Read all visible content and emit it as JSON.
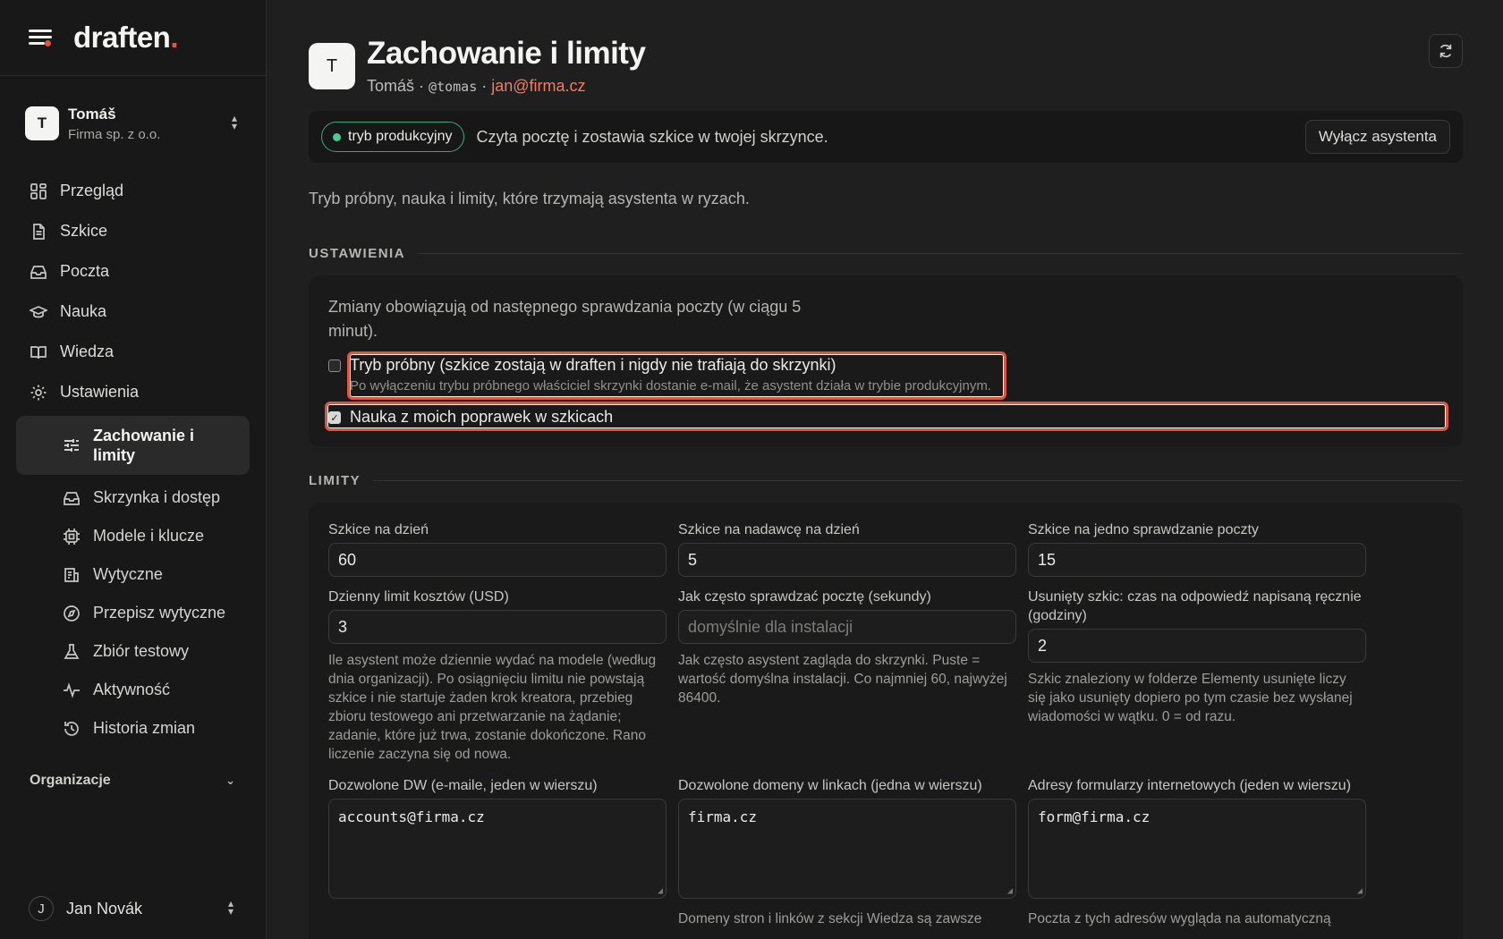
{
  "brand": {
    "name": "draften",
    "dot": "."
  },
  "account": {
    "initial": "T",
    "name": "Tomáš",
    "org": "Firma sp. z o.o."
  },
  "nav": {
    "items": [
      {
        "label": "Przegląd",
        "icon": "grid-icon"
      },
      {
        "label": "Szkice",
        "icon": "document-icon"
      },
      {
        "label": "Poczta",
        "icon": "inbox-icon"
      },
      {
        "label": "Nauka",
        "icon": "graduation-cap-icon"
      },
      {
        "label": "Wiedza",
        "icon": "book-icon"
      },
      {
        "label": "Ustawienia",
        "icon": "gear-icon"
      }
    ],
    "settings_sub": [
      {
        "label": "Zachowanie i limity",
        "icon": "sliders-icon",
        "active": true
      },
      {
        "label": "Skrzynka i dostęp",
        "icon": "inbox-icon"
      },
      {
        "label": "Modele i klucze",
        "icon": "cpu-icon"
      },
      {
        "label": "Wytyczne",
        "icon": "guidelines-icon"
      },
      {
        "label": "Przepisz wytyczne",
        "icon": "compass-icon"
      },
      {
        "label": "Zbiór testowy",
        "icon": "flask-icon"
      },
      {
        "label": "Aktywność",
        "icon": "activity-icon"
      },
      {
        "label": "Historia zmian",
        "icon": "history-icon"
      }
    ],
    "organizations_label": "Organizacje"
  },
  "user": {
    "initial": "J",
    "name": "Jan Novák"
  },
  "header": {
    "initial": "T",
    "title": "Zachowanie i limity",
    "owner": "Tomáš",
    "sep": "·",
    "handle": "@tomas",
    "email": "jan@firma.cz"
  },
  "status": {
    "badge": "tryb produkcyjny",
    "text": "Czyta pocztę i zostawia szkice w twojej skrzynce.",
    "disable_button": "Wyłącz asystenta"
  },
  "intro": "Tryb próbny, nauka i limity, które trzymają asystenta w ryzach.",
  "settings": {
    "heading": "USTAWIENIA",
    "note": "Zmiany obowiązują od następnego sprawdzania poczty (w ciągu 5 minut).",
    "trial": {
      "checked": false,
      "label": "Tryb próbny (szkice zostają w draften i nigdy nie trafiają do skrzynki)",
      "hint": "Po wyłączeniu trybu próbnego właściciel skrzynki dostanie e-mail, że asystent działa w trybie produkcyjnym."
    },
    "learning": {
      "checked": true,
      "label": "Nauka z moich poprawek w szkicach"
    }
  },
  "limits": {
    "heading": "LIMITY",
    "drafts_per_day": {
      "label": "Szkice na dzień",
      "value": "60"
    },
    "drafts_per_sender": {
      "label": "Szkice na nadawcę na dzień",
      "value": "5"
    },
    "drafts_per_check": {
      "label": "Szkice na jedno sprawdzanie poczty",
      "value": "15"
    },
    "cost_limit": {
      "label": "Dzienny limit kosztów (USD)",
      "value": "3",
      "help": "Ile asystent może dziennie wydać na modele (według dnia organizacji). Po osiągnięciu limitu nie powstają szkice i nie startuje żaden krok kreatora, przebieg zbioru testowego ani przetwarzanie na żądanie; zadanie, które już trwa, zostanie dokończone. Rano liczenie zaczyna się od nowa."
    },
    "check_interval": {
      "label": "Jak często sprawdzać pocztę (sekundy)",
      "placeholder": "domyślnie dla instalacji",
      "help": "Jak często asystent zagląda do skrzynki. Puste = wartość domyślna instalacji. Co najmniej 60, najwyżej 86400."
    },
    "deleted_draft": {
      "label": "Usunięty szkic: czas na odpowiedź napisaną ręcznie (godziny)",
      "value": "2",
      "help": "Szkic znaleziony w folderze Elementy usunięte liczy się jako usunięty dopiero po tym czasie bez wysłanej wiadomości w wątku. 0 = od razu."
    },
    "allowed_cc": {
      "label": "Dozwolone DW (e-maile, jeden w wierszu)",
      "value": "accounts@firma.cz"
    },
    "allowed_domains": {
      "label": "Dozwolone domeny w linkach (jedna w wierszu)",
      "value": "firma.cz",
      "help": "Domeny stron i linków z sekcji Wiedza są zawsze"
    },
    "form_addresses": {
      "label": "Adresy formularzy internetowych (jeden w wierszu)",
      "value": "form@firma.cz",
      "help": "Poczta z tych adresów wygląda na automatyczną"
    }
  },
  "colors": {
    "accent": "#e0563b",
    "email": "#ef7d62",
    "status_green": "#4cc992"
  }
}
